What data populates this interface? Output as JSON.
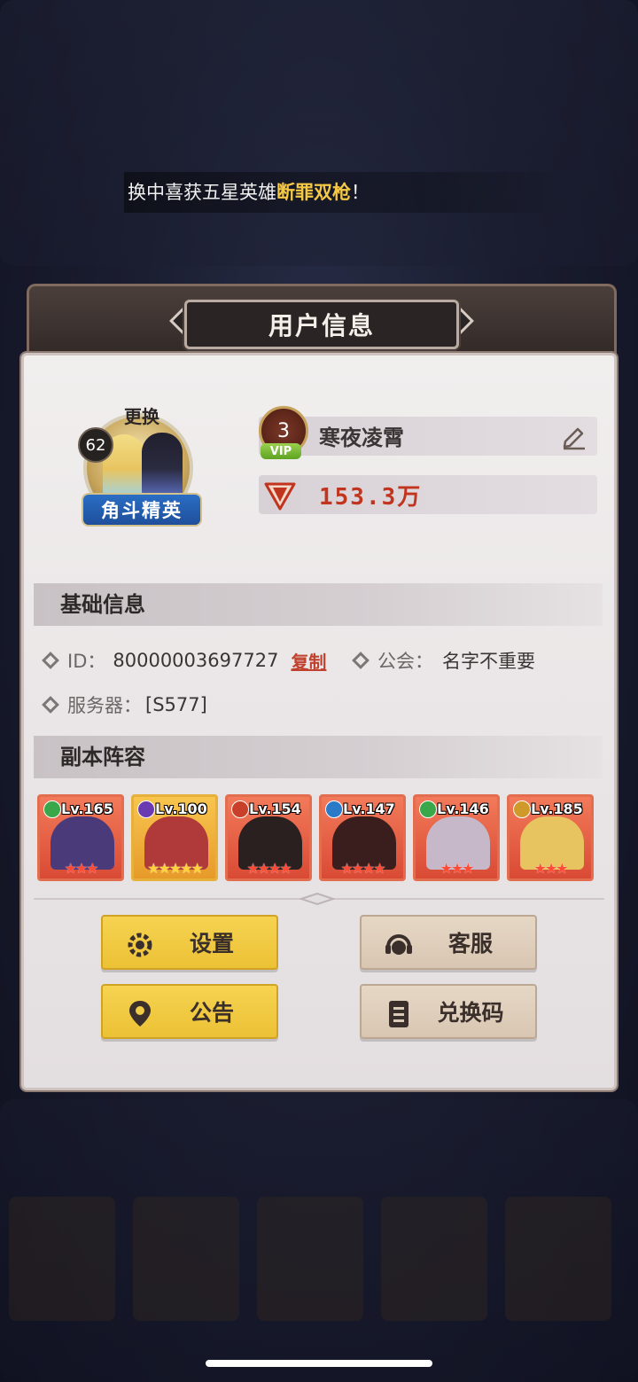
{
  "marquee": {
    "text": "换中喜获五星英雄",
    "highlight": "断罪双枪",
    "suffix": "！"
  },
  "panel": {
    "title": "用户信息"
  },
  "profile": {
    "swap_label": "更换",
    "level": "62",
    "rank_title": "角斗精英",
    "vip_level": "3",
    "vip_tag": "VIP",
    "player_name": "寒夜凌霄",
    "power": "153.3万"
  },
  "basic_info": {
    "section_title": "基础信息",
    "id_label": "ID：",
    "id_value": "80000003697727",
    "copy_label": "复制",
    "guild_label": "公会：",
    "guild_value": "名字不重要",
    "server_label": "服务器：",
    "server_value": "[S577]"
  },
  "lineup": {
    "section_title": "副本阵容",
    "heroes": [
      {
        "level": "Lv.165",
        "stars": "★★★",
        "element_color": "#3aa84a",
        "frame": "red",
        "art_color": "#4a3a7a"
      },
      {
        "level": "Lv.100",
        "stars": "★★★★★",
        "element_color": "#6a3ab0",
        "frame": "gold",
        "art_color": "#b03a3a"
      },
      {
        "level": "Lv.154",
        "stars": "★★★★",
        "element_color": "#c8402a",
        "frame": "red",
        "art_color": "#2a2020"
      },
      {
        "level": "Lv.147",
        "stars": "★★★★",
        "element_color": "#2a7ac8",
        "frame": "red",
        "art_color": "#3a1e1e"
      },
      {
        "level": "Lv.146",
        "stars": "★★★",
        "element_color": "#3aa84a",
        "frame": "red",
        "art_color": "#c6b8c8"
      },
      {
        "level": "Lv.185",
        "stars": "★★★",
        "element_color": "#d09a2a",
        "frame": "red",
        "art_color": "#e8c460"
      }
    ]
  },
  "buttons": {
    "settings": "设置",
    "customer_service": "客服",
    "announcement": "公告",
    "redeem_code": "兑换码"
  }
}
